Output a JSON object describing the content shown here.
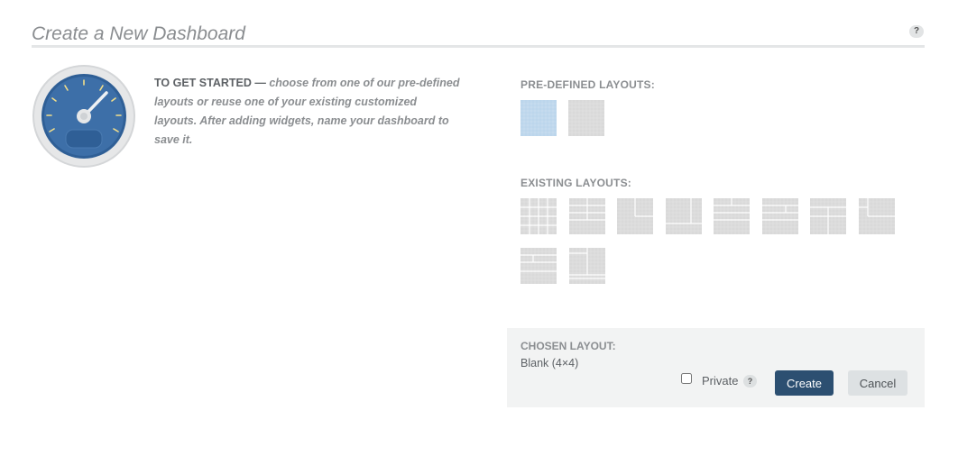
{
  "page": {
    "title": "Create a New Dashboard",
    "help_label": "?"
  },
  "intro": {
    "lead": "TO GET STARTED —",
    "body": " choose from one of our pre-defined layouts or reuse one of your existing customized layouts. After adding widgets, name your dashboard to save it."
  },
  "predefined": {
    "label": "PRE-DEFINED LAYOUTS:",
    "items": [
      {
        "name": "Blank (4×4)",
        "selected": true
      },
      {
        "name": "Blank",
        "selected": false
      }
    ]
  },
  "existing": {
    "label": "EXISTING LAYOUTS:",
    "count": 10
  },
  "chosen": {
    "label": "CHOSEN LAYOUT:",
    "value": "Blank (4×4)",
    "private_label": "Private",
    "private_checked": false,
    "help_label": "?",
    "create_label": "Create",
    "cancel_label": "Cancel"
  },
  "colors": {
    "accent": "#2c4f71",
    "selected_thumb": "#bcd6ec",
    "thumb": "#d9d9d9",
    "gauge_face": "#3d6fa8"
  },
  "icons": {
    "gauge": "gauge-icon",
    "help": "help-icon"
  }
}
